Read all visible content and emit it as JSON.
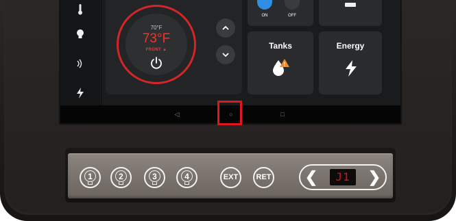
{
  "sidebar": {
    "items": [
      {
        "icon": "thermometer-icon",
        "glyph": "🌡"
      },
      {
        "icon": "lightbulb-icon",
        "glyph": "💡"
      },
      {
        "icon": "signal-icon",
        "glyph": ")))"
      },
      {
        "icon": "lightning-icon",
        "glyph": "⚡"
      }
    ]
  },
  "thermostat": {
    "set_temp": "70°F",
    "current_temp": "73°F",
    "zone": "FRONT",
    "flame_glyph": "🔥",
    "up_glyph": "⌃",
    "down_glyph": "⌄"
  },
  "toggle": {
    "on_label": "ON",
    "off_label": "OFF"
  },
  "tiles": [
    {
      "label": "Tanks",
      "icon": "tank-warning-icon"
    },
    {
      "label": "Energy",
      "icon": "energy-bolt-icon",
      "glyph": "⚡"
    }
  ],
  "navbar": {
    "back_glyph": "◁",
    "home_glyph": "○",
    "recents_glyph": "□"
  },
  "panel": {
    "light_buttons": [
      "1",
      "2",
      "3",
      "4"
    ],
    "ext_label": "EXT",
    "ret_label": "RET",
    "prev_glyph": "❮",
    "next_glyph": "❯",
    "display_value": "J1"
  },
  "colors": {
    "accent_red": "#d3262b",
    "temp_red": "#ff2e2e",
    "toggle_blue": "#2f8de4",
    "highlight": "#e0161c"
  }
}
